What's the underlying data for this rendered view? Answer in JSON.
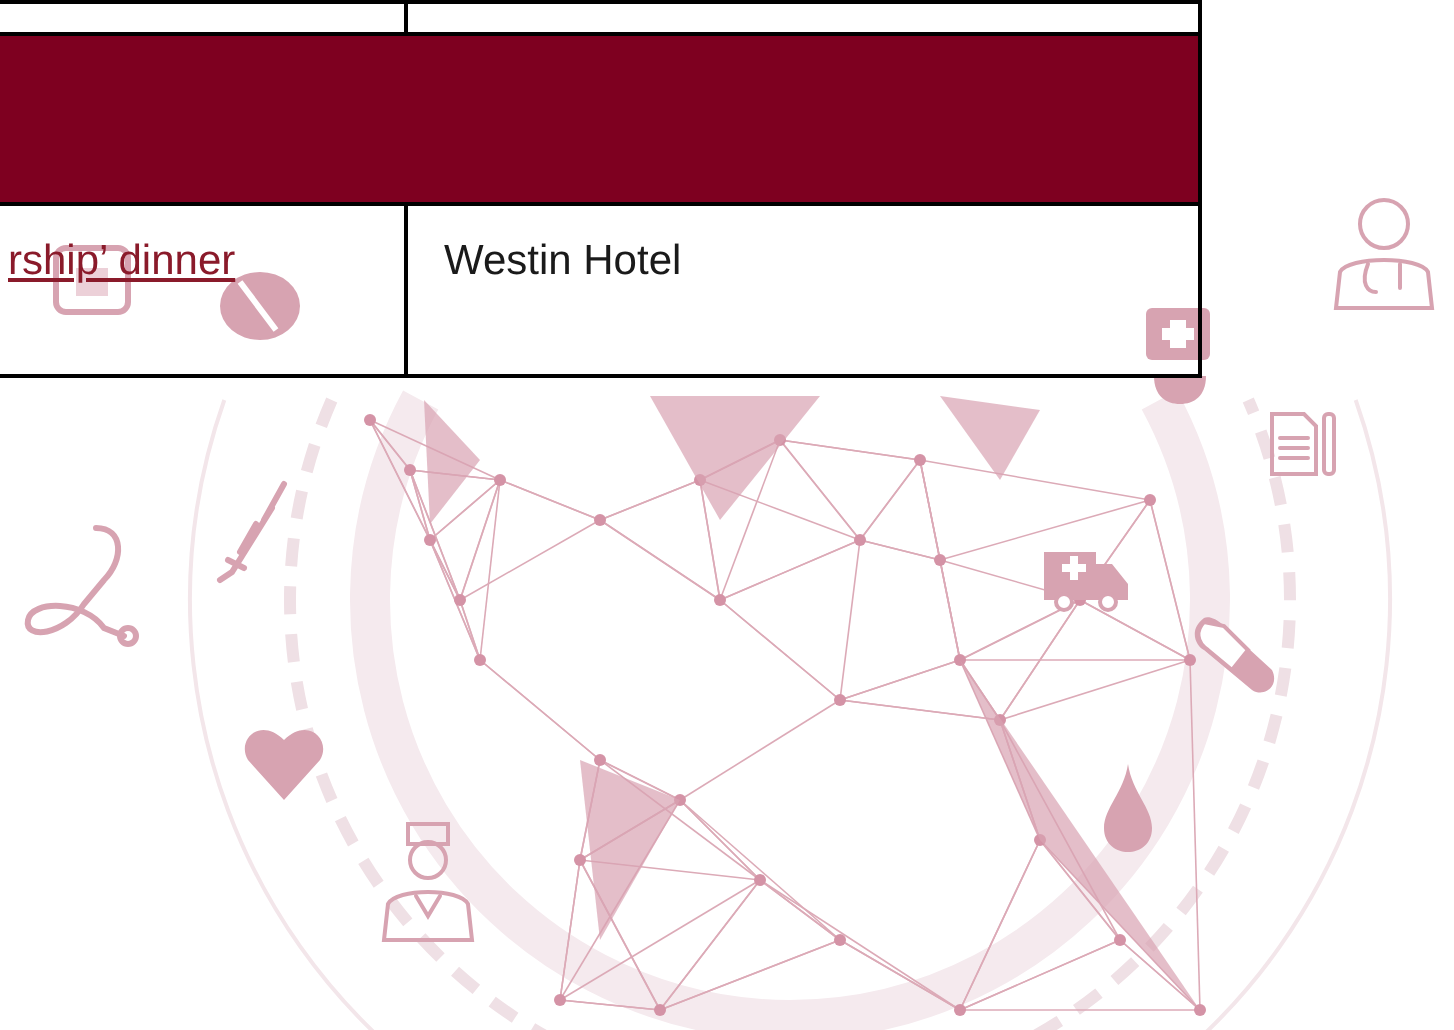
{
  "table": {
    "rows": [
      {
        "kind": "empty"
      },
      {
        "kind": "band"
      },
      {
        "kind": "data",
        "cells": [
          {
            "text": "rship’ dinner",
            "link": true
          },
          {
            "text": "Westin Hotel",
            "link": false
          }
        ]
      }
    ]
  }
}
